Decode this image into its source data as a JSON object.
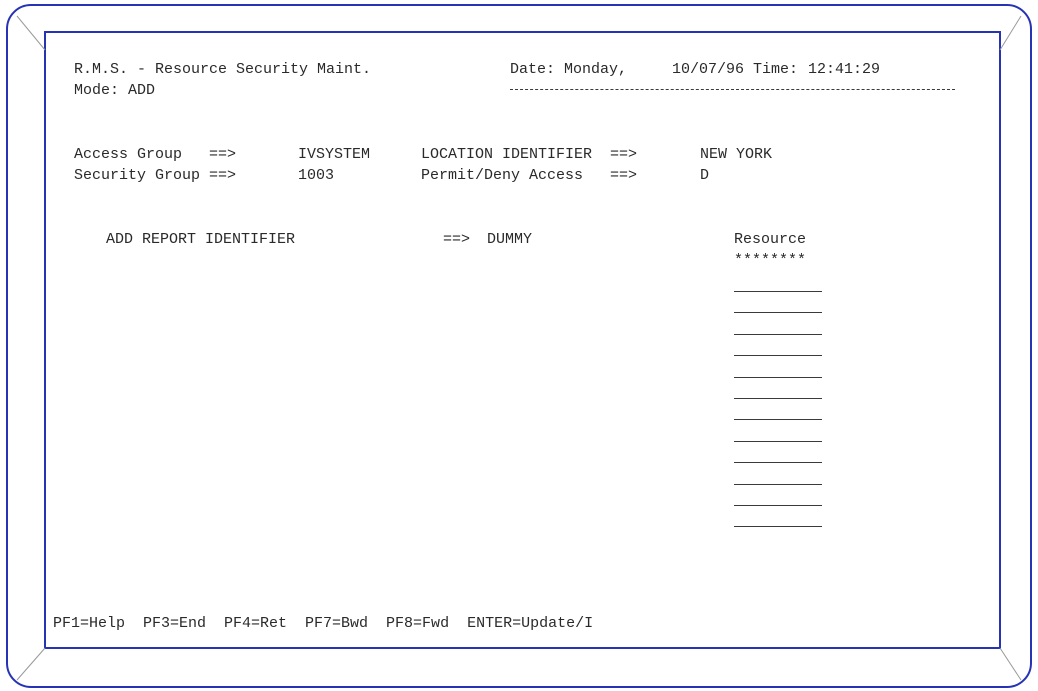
{
  "header": {
    "title": "R.M.S. - Resource Security Maint.",
    "date_label": "Date:",
    "day": "Monday,",
    "date": "10/07/96",
    "time_label": "Time:",
    "time": "12:41:29",
    "mode_label": "Mode:",
    "mode": "ADD"
  },
  "form": {
    "access_group_label": "Access Group   ==>",
    "access_group_value": "IVSYSTEM",
    "location_label": "LOCATION IDENTIFIER  ==>",
    "location_value": "NEW YORK",
    "security_group_label": "Security Group ==>",
    "security_group_value": "1003",
    "permit_label": "Permit/Deny Access   ==>",
    "permit_value": "D",
    "report_label": "ADD REPORT IDENTIFIER",
    "report_arrow": "==>",
    "report_value": "DUMMY"
  },
  "resource": {
    "header": "Resource",
    "mask": "********",
    "field_count": 12
  },
  "footer": {
    "keys": "PF1=Help  PF3=End  PF4=Ret  PF7=Bwd  PF8=Fwd  ENTER=Update/I"
  },
  "colors": {
    "frame": "#2633b5",
    "text": "#2a2a2a",
    "bezel": "#9a9a9a"
  }
}
